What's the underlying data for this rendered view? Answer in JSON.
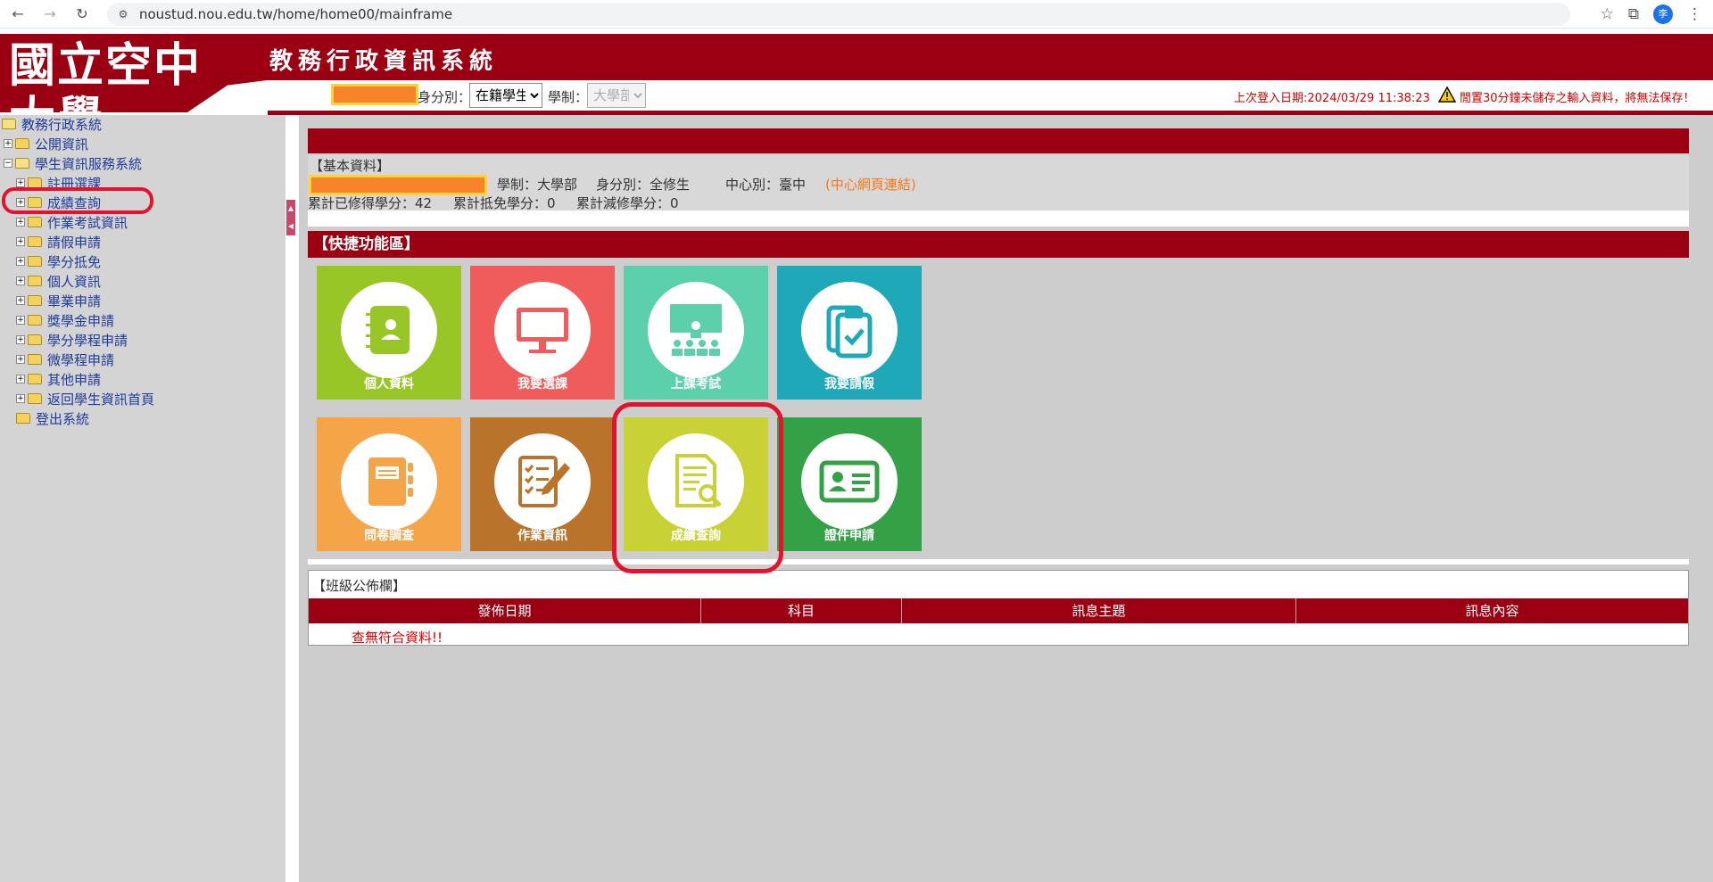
{
  "browser": {
    "url": "noustud.nou.edu.tw/home/home00/mainframe",
    "profile_initial": "李"
  },
  "header": {
    "logo_text": "國立空中大學",
    "system_title": "教務行政資訊系統",
    "identity_label": "身分別：",
    "identity_value": "在籍學生",
    "school_label": "學制：",
    "school_value": "大學部",
    "last_login": "上次登入日期:2024/03/29 11:38:23",
    "idle_warning": "閒置30分鐘未儲存之輸入資料，將無法保存！"
  },
  "sidebar": {
    "root": "教務行政系統",
    "public_info": "公開資訊",
    "student_service": "學生資訊服務系統",
    "items": [
      "註冊選課",
      "成績查詢",
      "作業考試資訊",
      "請假申請",
      "學分抵免",
      "個人資訊",
      "畢業申請",
      "獎學金申請",
      "學分學程申請",
      "微學程申請",
      "其他申請",
      "返回學生資訊首頁"
    ],
    "logout": "登出系統"
  },
  "basic": {
    "title": "【基本資料】",
    "school": "學制：大學部",
    "identity": "身分別：全修生",
    "center": "中心別：臺中",
    "center_link": "(中心網頁連結)",
    "credits_earned": "累計已修得學分：42",
    "credits_waived": "累計抵免學分：0",
    "credits_reduced": "累計減修學分：0"
  },
  "quick": {
    "title": "【快捷功能區】",
    "tiles": [
      {
        "label": "個人資料",
        "color": "#97c626"
      },
      {
        "label": "我要選課",
        "color": "#f05c5c"
      },
      {
        "label": "上課考試",
        "color": "#5ccfab"
      },
      {
        "label": "我要請假",
        "color": "#1ea8b8"
      },
      {
        "label": "問卷調查",
        "color": "#f5a448"
      },
      {
        "label": "作業資訊",
        "color": "#b9732b"
      },
      {
        "label": "成績查詢",
        "color": "#c9d234"
      },
      {
        "label": "證件申請",
        "color": "#35a146"
      }
    ]
  },
  "board": {
    "caption": "【班級公佈欄】",
    "columns": [
      "發佈日期",
      "科目",
      "訊息主題",
      "訊息內容"
    ],
    "empty": "查無符合資料!!"
  }
}
